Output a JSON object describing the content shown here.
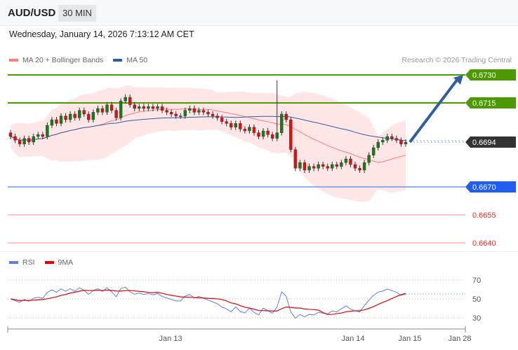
{
  "header": {
    "pair": "AUD/USD",
    "timeframe": "30 MIN"
  },
  "date": "Wednesday, January 14, 2026 7:13:12 AM CET",
  "legend": {
    "ma20": "MA 20 + Bollinger Bands",
    "ma50": "MA 50",
    "rsi": "RSI",
    "rsi_ma": "9MA"
  },
  "credit": "Research © 2026 Trading Central",
  "colors": {
    "resistance": "#4a9a00",
    "current": "#333333",
    "pivot": "#1f5ef0",
    "support": "#ff2222",
    "ma20": "#ff7b7b",
    "ma50": "#2d5fa0",
    "arrow": "#2f5f9e"
  },
  "chart_data": {
    "type": "candlestick",
    "price_range": [
      0.6635,
      0.6735
    ],
    "levels": [
      {
        "value": "0.6730",
        "kind": "resistance"
      },
      {
        "value": "0.6715",
        "kind": "resistance"
      },
      {
        "value": "0.6694",
        "kind": "current"
      },
      {
        "value": "0.6670",
        "kind": "pivot"
      },
      {
        "value": "0.6655",
        "kind": "support"
      },
      {
        "value": "0.6640",
        "kind": "support"
      }
    ],
    "closes": [
      0.6697,
      0.6695,
      0.6693,
      0.6696,
      0.6694,
      0.6697,
      0.6698,
      0.6697,
      0.6703,
      0.6706,
      0.6704,
      0.6708,
      0.6706,
      0.6709,
      0.6707,
      0.6711,
      0.6709,
      0.6706,
      0.671,
      0.6712,
      0.671,
      0.6714,
      0.6711,
      0.6707,
      0.6716,
      0.6718,
      0.6714,
      0.6712,
      0.6713,
      0.6712,
      0.6713,
      0.6712,
      0.6713,
      0.6711,
      0.671,
      0.6709,
      0.6708,
      0.6708,
      0.6711,
      0.6712,
      0.671,
      0.6711,
      0.671,
      0.6709,
      0.6708,
      0.6707,
      0.6705,
      0.6704,
      0.6702,
      0.6704,
      0.6701,
      0.67,
      0.6702,
      0.6699,
      0.6697,
      0.67,
      0.6698,
      0.6696,
      0.6699,
      0.6709,
      0.6706,
      0.669,
      0.668,
      0.6683,
      0.6679,
      0.6681,
      0.668,
      0.6682,
      0.6681,
      0.668,
      0.6682,
      0.6681,
      0.6683,
      0.6685,
      0.6682,
      0.668,
      0.6679,
      0.6683,
      0.6687,
      0.6691,
      0.6694,
      0.6695,
      0.6697,
      0.6696,
      0.6695,
      0.6693,
      0.6694
    ],
    "spike": {
      "index": 58,
      "high": 0.6727
    },
    "target": 0.673,
    "rsi_axis": [
      "70",
      "50",
      "30"
    ],
    "x_labels": [
      "Jan 13",
      "Jan 14",
      "Jan 15",
      "Jan 28"
    ]
  }
}
